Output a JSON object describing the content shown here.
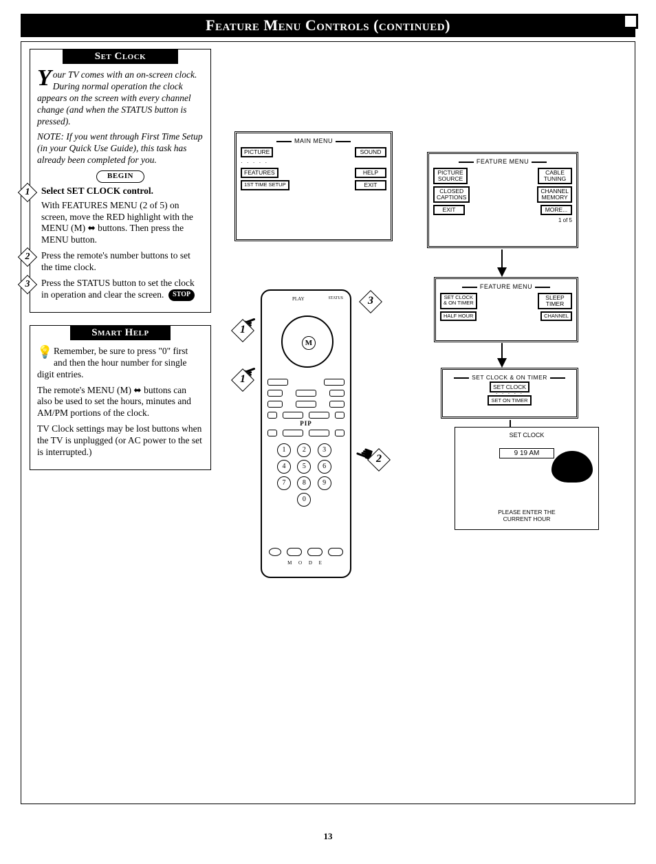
{
  "header": {
    "title": "Feature Menu Controls (continued)"
  },
  "setClock": {
    "heading": "Set Clock",
    "introFirst": "Y",
    "introRest": "our TV comes with an on-screen clock. During normal operation the clock appears on the screen with every channel change (and when the STATUS button is pressed).",
    "note": "NOTE: If you went through First Time Setup (in your Quick Use Guide), this task has already been completed for you.",
    "begin": "BEGIN",
    "step1a": "Select SET CLOCK control.",
    "step1b": "With FEATURES MENU (2 of 5) on screen, move the RED highlight with the MENU (M) ⬌ buttons. Then press the MENU button.",
    "step2": "Press the remote's number buttons to set the time clock.",
    "step3": "Press the STATUS button to set the clock in operation and clear the screen.",
    "stop": "STOP"
  },
  "smartHelp": {
    "heading": "Smart Help",
    "p1": "Remember, be sure to press \"0\" first and then the hour number for single digit entries.",
    "p2": "The remote's MENU (M) ⬌ buttons can also be used to set the hours, minutes and AM/PM portions of the clock.",
    "p3": "TV Clock settings may be lost buttons when the TV is unplugged (or AC power to the set is interrupted.)"
  },
  "screens": {
    "main": {
      "title": "MAIN MENU",
      "items": [
        "PICTURE",
        "SOUND",
        "FEATURES",
        "HELP",
        "1ST TIME SETUP",
        "EXIT"
      ]
    },
    "feature1": {
      "title": "FEATURE MENU",
      "items": [
        "PICTURE\nSOURCE",
        "CABLE\nTUNING",
        "CLOSED\nCAPTIONS",
        "CHANNEL\nMEMORY",
        "EXIT",
        "MORE..."
      ],
      "foot": "1 of 5"
    },
    "feature2": {
      "title": "FEATURE MENU",
      "items": [
        "SET CLOCK\n& ON TIMER",
        "SLEEP\nTIMER",
        "HALF HOUR",
        "CHANNEL"
      ]
    },
    "setclock": {
      "title": "SET CLOCK & ON TIMER",
      "items": [
        "SET CLOCK",
        "SET ON TIMER"
      ]
    },
    "entry": {
      "title": "SET CLOCK",
      "time": "9  19 AM",
      "msg1": "PLEASE ENTER THE",
      "msg2": "CURRENT HOUR"
    }
  },
  "remote": {
    "pip": "PIP",
    "mode": "M  O  D  E",
    "play": "PLAY",
    "status": "STATUS",
    "m": "M"
  },
  "pageNumber": "13"
}
